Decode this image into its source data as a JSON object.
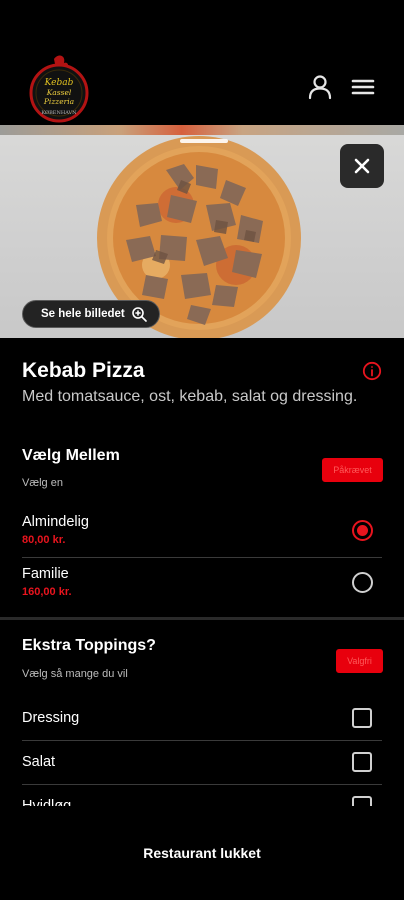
{
  "header": {
    "logo_text_line1": "Kebab",
    "logo_text_line2": "Kassel Pizzeria",
    "logo_text_line3": "KØBENHAVN"
  },
  "hero": {
    "see_full_image_label": "Se hele billedet"
  },
  "product": {
    "name": "Kebab Pizza",
    "description": "Med tomatsauce, ost, kebab, salat og dressing."
  },
  "size_section": {
    "title": "Vælg Mellem",
    "subtitle": "Vælg en",
    "badge": "Påkrævet",
    "options": [
      {
        "label": "Almindelig",
        "price": "80,00 kr.",
        "selected": true
      },
      {
        "label": "Familie",
        "price": "160,00 kr.",
        "selected": false
      }
    ]
  },
  "toppings_section": {
    "title": "Ekstra Toppings?",
    "subtitle": "Vælg så mange du vil",
    "badge": "Valgfri",
    "options": [
      {
        "label": "Dressing"
      },
      {
        "label": "Salat"
      },
      {
        "label": "Hvidløg"
      }
    ]
  },
  "footer": {
    "status_label": "Restaurant lukket"
  },
  "colors": {
    "accent": "#e8141e",
    "background": "#000000"
  }
}
